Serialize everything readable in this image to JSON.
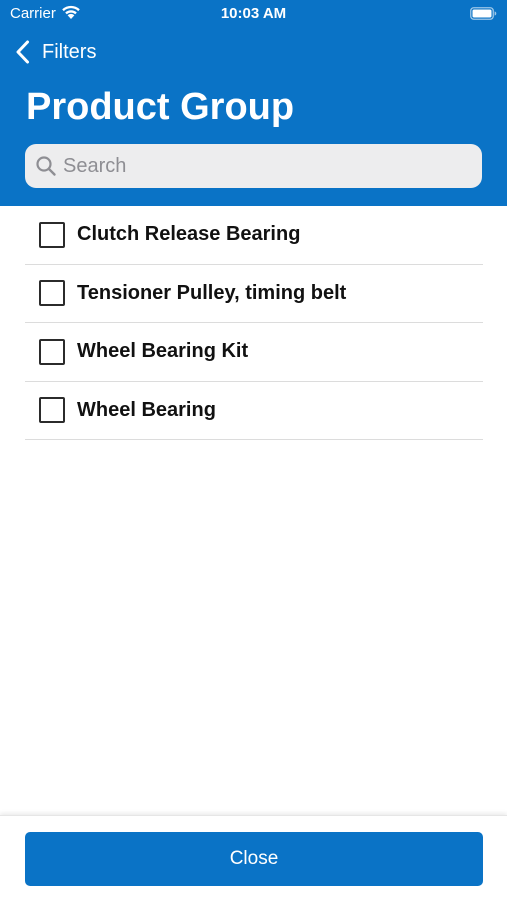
{
  "status_bar": {
    "carrier": "Carrier",
    "time": "10:03 AM",
    "icons": [
      "wifi-icon",
      "battery-icon"
    ]
  },
  "nav": {
    "back_label": "Filters",
    "back_icon": "chevron-left-icon"
  },
  "page": {
    "title": "Product Group"
  },
  "search": {
    "placeholder": "Search",
    "value": "",
    "icon": "magnifying-glass-icon"
  },
  "filters": {
    "items": [
      {
        "label": "Clutch Release Bearing",
        "checked": false
      },
      {
        "label": "Tensioner Pulley, timing belt",
        "checked": false
      },
      {
        "label": "Wheel Bearing Kit",
        "checked": false
      },
      {
        "label": "Wheel Bearing",
        "checked": false
      }
    ]
  },
  "footer": {
    "close_label": "Close"
  },
  "colors": {
    "brand_blue": "#0a73c6",
    "search_bg": "#ededee",
    "divider": "#dcdcdc",
    "text_dark": "#111111"
  }
}
